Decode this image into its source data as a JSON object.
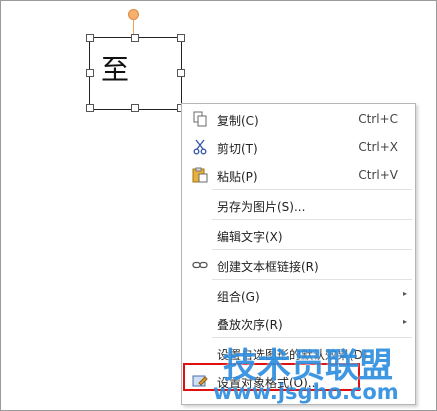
{
  "textbox": {
    "text": "至"
  },
  "menu": {
    "items": [
      {
        "label": "复制(C)",
        "shortcut": "Ctrl+C",
        "icon": "copy-icon"
      },
      {
        "label": "剪切(T)",
        "shortcut": "Ctrl+X",
        "icon": "scissors-icon"
      },
      {
        "label": "粘贴(P)",
        "shortcut": "Ctrl+V",
        "icon": "paste-icon"
      },
      {
        "label": "另存为图片(S)..."
      },
      {
        "label": "编辑文字(X)"
      },
      {
        "label": "创建文本框链接(R)",
        "icon": "link-icon"
      },
      {
        "label": "组合(G)",
        "submenu": "▸"
      },
      {
        "label": "叠放次序(R)",
        "submenu": "▸"
      },
      {
        "label": "设置自选图形的默认效果(D)"
      },
      {
        "label": "设置对象格式(O)...",
        "icon": "format-object-icon"
      }
    ]
  },
  "watermark": {
    "line1": "技术员联盟",
    "line2": "www.jsgho.com"
  },
  "colors": {
    "highlight": "#e01010",
    "watermark": "#2f8fe0",
    "rotation_handle": "#f5b070"
  }
}
